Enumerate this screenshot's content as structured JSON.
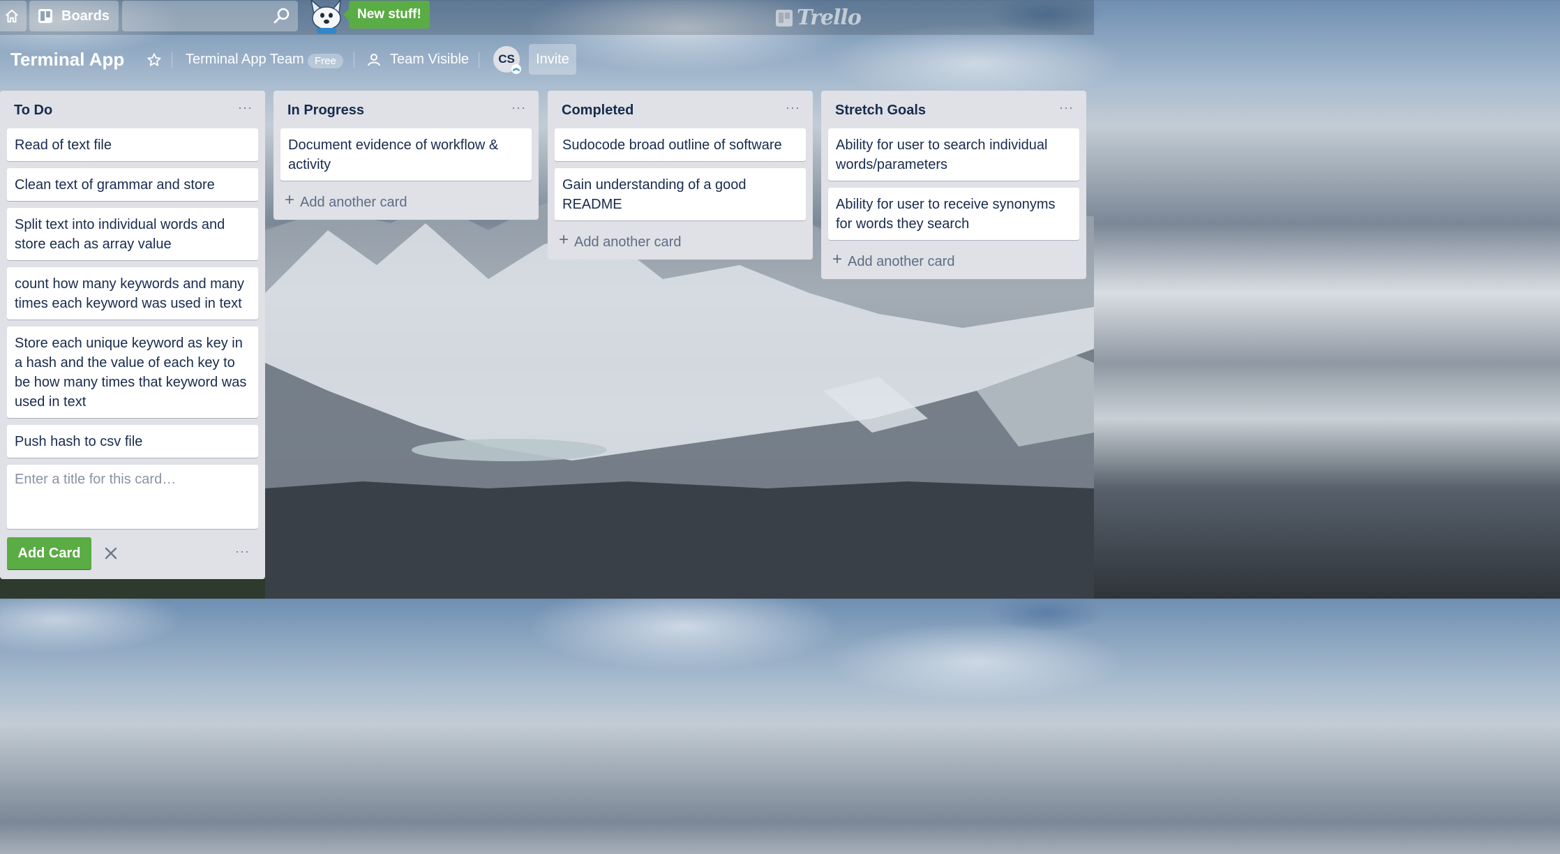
{
  "header": {
    "boards_label": "Boards",
    "search_placeholder": "",
    "new_stuff_label": "New stuff!",
    "logo_text": "Trello"
  },
  "board": {
    "title": "Terminal App",
    "team_name": "Terminal App Team",
    "team_badge": "Free",
    "visibility": "Team Visible",
    "member_initials": "CS",
    "invite_label": "Invite"
  },
  "lists": [
    {
      "title": "To Do",
      "menu": "···",
      "cards": [
        "Read of text file",
        "Clean text of grammar and store",
        "Split text into individual words and store each as array value",
        "count how many keywords and many times each keyword was used in text",
        "Store each unique keyword as key in a hash and the value of each key to be how many times that keyword was used in text",
        "Push hash to csv file"
      ],
      "composer_placeholder": "Enter a title for this card…",
      "add_button": "Add Card",
      "composer_menu": "···"
    },
    {
      "title": "In Progress",
      "menu": "···",
      "cards": [
        "Document evidence of workflow & activity"
      ],
      "add_label": "Add another card"
    },
    {
      "title": "Completed",
      "menu": "···",
      "cards": [
        "Sudocode broad outline of software",
        "Gain understanding of a good README"
      ],
      "add_label": "Add another card"
    },
    {
      "title": "Stretch Goals",
      "menu": "···",
      "cards": [
        "Ability for user to search individual words/parameters",
        "Ability for user to receive synonyms for words they search"
      ],
      "add_label": "Add another card"
    }
  ],
  "colors": {
    "primary_green": "#5aac44",
    "list_bg": "#dfe1e6",
    "text": "#172b4d"
  }
}
